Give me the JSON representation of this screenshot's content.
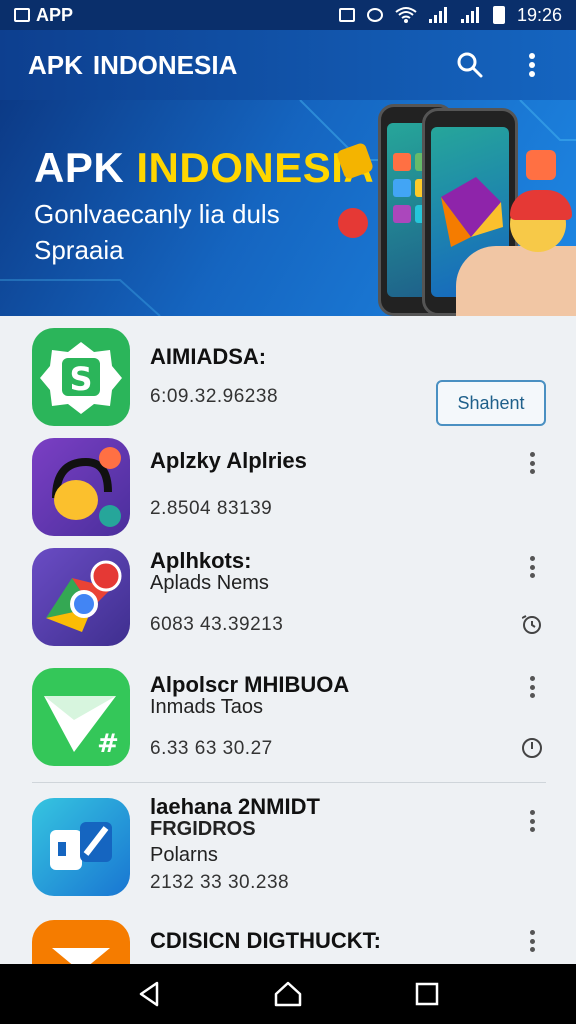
{
  "status_bar": {
    "app_label": "APP",
    "time": "19:26",
    "icons": [
      "vibrate-icon",
      "alarm-icon",
      "wifi-icon",
      "signal-icon",
      "signal-icon",
      "battery-icon"
    ]
  },
  "toolbar": {
    "logo_short": "APK",
    "logo_name": "INDONESIA",
    "search_icon": "search-icon",
    "menu_icon": "overflow-menu-icon"
  },
  "banner": {
    "title_part1": "APK",
    "title_part2": "INDONESIA",
    "subtitle": "Gonlvaecanly lia duls Spraaia"
  },
  "apps": [
    {
      "name": "AIMIADSA:",
      "subtitle": "",
      "meta": "6:09.32.96238",
      "action_label": "Shahent",
      "icon": "shopee-s-icon",
      "color": "#2bb55a"
    },
    {
      "name": "Aplzky Alplries",
      "subtitle": "",
      "meta": "2.8504 83139",
      "icon": "headphones-app-icon",
      "color": "#6a3fb0"
    },
    {
      "name": "Aplhkots:",
      "subtitle": "Aplads Nems",
      "meta": "6083 43.39213",
      "icon": "chrome-like-icon",
      "color": "#5b3fa6"
    },
    {
      "name": "Alpolscr MHIBUOA",
      "subtitle": "Inmads Taos",
      "meta": "6.33 63 30.27",
      "icon": "send-arrow-icon",
      "color": "#34c759"
    },
    {
      "name": "laehana 2NMIDT",
      "subtitle": "FRGIDROS",
      "subtitle2": "Polarns",
      "meta": "2132 33 30.238",
      "icon": "share-app-icon",
      "color": "#29a8d6"
    },
    {
      "name": "CDISICN DIGTHUCKT:",
      "subtitle": "",
      "meta": "",
      "icon": "red-app-icon",
      "color": "#f57c00"
    }
  ],
  "colors": {
    "toolbar": "#1565c0",
    "accent_yellow": "#ffd600",
    "button_border": "#4a90c2"
  }
}
